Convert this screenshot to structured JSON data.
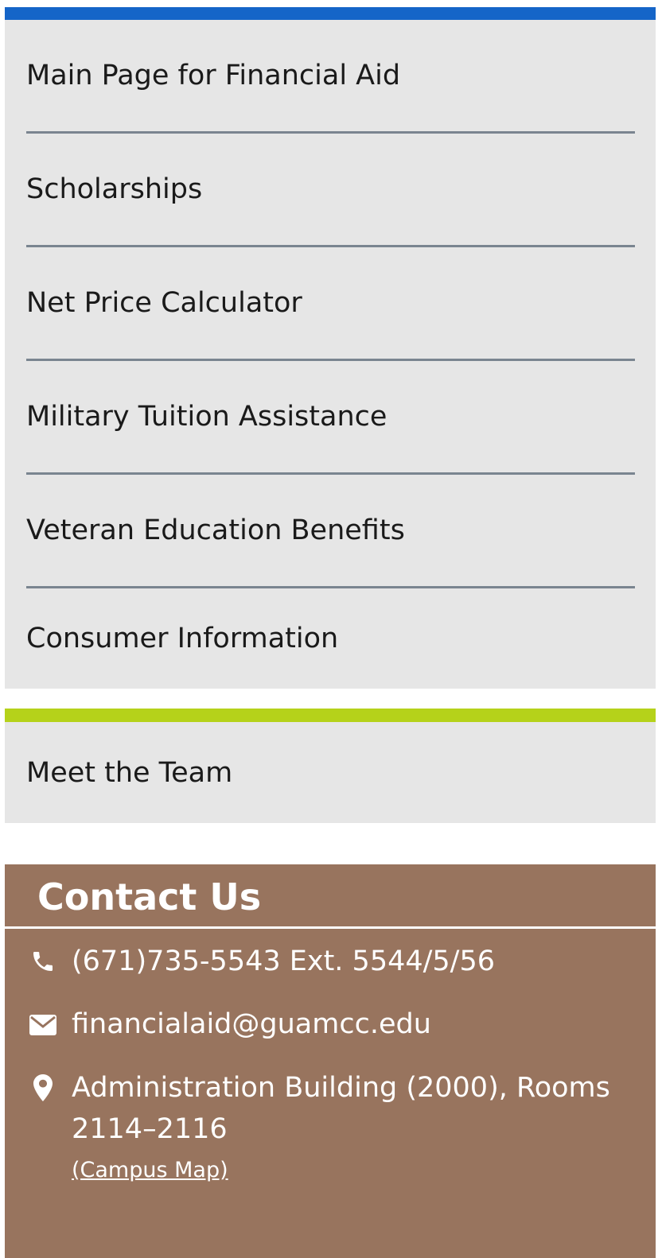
{
  "nav": {
    "items": [
      {
        "label": "Main Page for Financial Aid"
      },
      {
        "label": "Scholarships"
      },
      {
        "label": "Net Price Calculator"
      },
      {
        "label": "Military Tuition Assistance"
      },
      {
        "label": "Veteran Education Benefits"
      },
      {
        "label": "Consumer Information"
      }
    ],
    "accent_color": "#1565c8"
  },
  "team": {
    "label": "Meet the Team",
    "accent_color": "#b5d21a"
  },
  "contact": {
    "title": "Contact Us",
    "phone": "(671)735-5543 Ext. 5544/5/56",
    "email": "financialaid@guamcc.edu",
    "address": "Administration Building (2000), Rooms 2114–2116",
    "map_link": "(Campus Map)",
    "background_color": "#98745e",
    "icons": [
      "phone-icon",
      "envelope-icon",
      "map-marker-icon"
    ]
  }
}
